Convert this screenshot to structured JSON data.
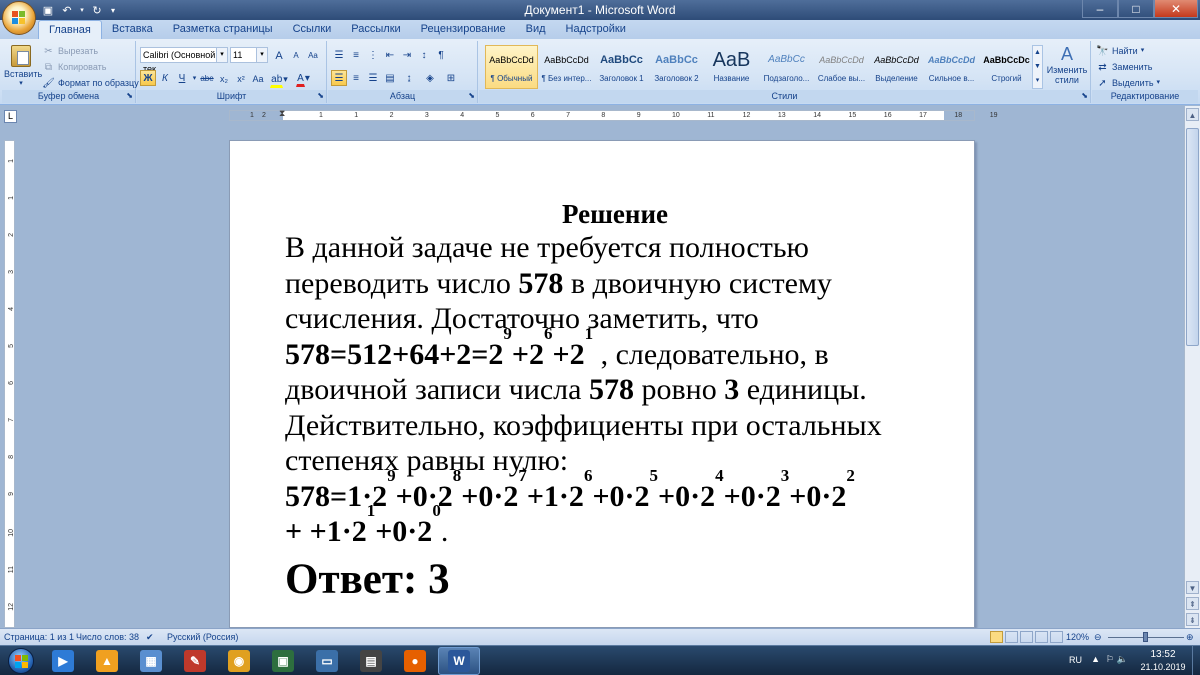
{
  "window": {
    "title": "Документ1 - Microsoft Word",
    "buttons": {
      "minimize": "–",
      "maximize": "□",
      "close": "✕"
    }
  },
  "quick_access": [
    {
      "name": "save-icon",
      "glyph": "💾"
    },
    {
      "name": "undo-icon",
      "glyph": "↶"
    },
    {
      "name": "redo-icon",
      "glyph": "↷"
    },
    {
      "name": "customize-qat-icon",
      "glyph": "▾"
    }
  ],
  "tabs": [
    "Главная",
    "Вставка",
    "Разметка страницы",
    "Ссылки",
    "Рассылки",
    "Рецензирование",
    "Вид",
    "Надстройки"
  ],
  "active_tab": "Главная",
  "ribbon": {
    "clipboard": {
      "paste": "Вставить",
      "cut": "Вырезать",
      "copy": "Копировать",
      "format_painter": "Формат по образцу",
      "label": "Буфер обмена"
    },
    "font": {
      "font_name": "Calibri (Основной тек",
      "font_size": "11",
      "grow": "A",
      "shrink": "A",
      "clear": "Aa",
      "bold": "Ж",
      "italic": "К",
      "underline": "Ч",
      "strike": "abe",
      "subscript": "x₂",
      "superscript": "x²",
      "case": "Aa",
      "highlight": "ab",
      "color": "A",
      "label": "Шрифт"
    },
    "paragraph": {
      "label": "Абзац",
      "pilcrow": "¶"
    },
    "styles": {
      "items": [
        {
          "sample": "AaBbCcDd",
          "name": "¶ Обычный"
        },
        {
          "sample": "AaBbCcDd",
          "name": "¶ Без интер..."
        },
        {
          "sample": "AaBbCc",
          "name": "Заголовок 1"
        },
        {
          "sample": "AaBbCc",
          "name": "Заголовок 2"
        },
        {
          "sample": "AaB",
          "name": "Название"
        },
        {
          "sample": "AaBbCc",
          "name": "Подзаголо..."
        },
        {
          "sample": "AaBbCcDd",
          "name": "Слабое вы..."
        },
        {
          "sample": "AaBbCcDd",
          "name": "Выделение"
        },
        {
          "sample": "AaBbCcDd",
          "name": "Сильное в..."
        },
        {
          "sample": "AaBbCcDc",
          "name": "Строгий"
        }
      ],
      "change_styles": "Изменить стили",
      "label": "Стили"
    },
    "editing": {
      "find": "Найти",
      "replace": "Заменить",
      "select": "Выделить",
      "label": "Редактирование"
    }
  },
  "ruler": {
    "h_ticks": [
      "1",
      "2",
      "1",
      "1",
      "2",
      "3",
      "4",
      "5",
      "6",
      "7",
      "8",
      "9",
      "10",
      "11",
      "12",
      "13",
      "14",
      "15",
      "16",
      "17",
      "18",
      "19"
    ],
    "v_ticks": [
      "1",
      "1",
      "2",
      "3",
      "4",
      "5",
      "6",
      "7",
      "8",
      "9",
      "10",
      "11",
      "12"
    ]
  },
  "document": {
    "heading": "Решение",
    "p1": "В данной задаче не требуется полностью переводить число ",
    "n578": "578",
    "p1b": " в двоичную систему счисления. Достаточно заметить, что",
    "eq1": "578=512+64+2=2",
    "e9": "9",
    "plus2": "+2",
    "e6": "6",
    "e1": "1",
    "p2a": " , следовательно, в двоичной записи числа ",
    "p2b": " ровно ",
    "three": "3",
    "p2c": " единицы. Действительно, коэффициенты при остальных степенях равны нулю:",
    "eq2_terms": [
      {
        "base": "578=1·2",
        "exp": "9"
      },
      {
        "base": "+0·2",
        "exp": "8"
      },
      {
        "base": "+0·2",
        "exp": "7"
      },
      {
        "base": "+1·2",
        "exp": "6"
      },
      {
        "base": "+0·2",
        "exp": "5"
      },
      {
        "base": "+0·2",
        "exp": "4"
      },
      {
        "base": "+0·2",
        "exp": "3"
      },
      {
        "base": "+0·2",
        "exp": "2"
      },
      {
        "base": "+ +1·2",
        "exp": "1"
      },
      {
        "base": "+0·2",
        "exp": "0"
      }
    ],
    "period": ".",
    "answer": "Ответ: 3"
  },
  "status": {
    "page": "Страница: 1 из 1",
    "words": "Число слов: 38",
    "language": "Русский (Россия)",
    "zoom": "120%"
  },
  "taskbar": {
    "apps": [
      "media-player-icon",
      "aimp-icon",
      "network-icon",
      "pdf-icon",
      "chrome-icon",
      "terminal-icon",
      "monitor-icon",
      "film-icon",
      "firefox-icon",
      "word-icon"
    ],
    "lang": "RU",
    "time": "13:52",
    "date": "21.10.2019"
  },
  "colors": {
    "ribbon_text": "#15428b",
    "title_bar": "#2e4c78",
    "active_highlight": "#f8c94d"
  }
}
